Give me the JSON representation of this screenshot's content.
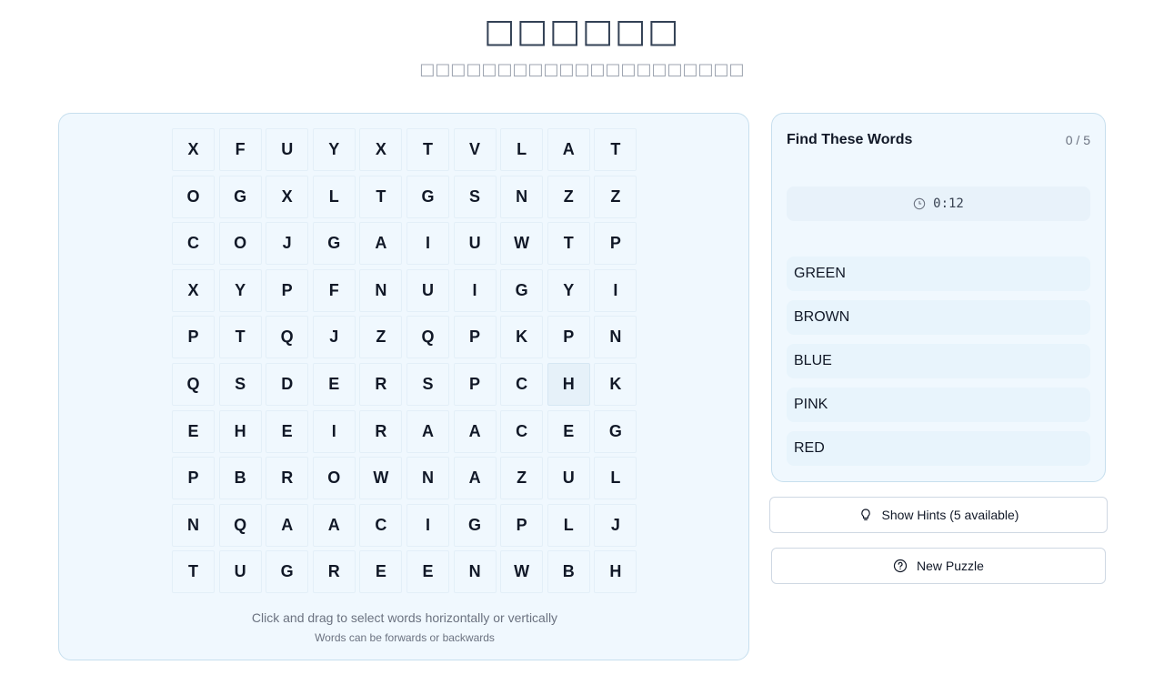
{
  "header": {
    "title": "□□□□□□",
    "subtitle": "□□□□□□□□□□□□□□□□□□□□□"
  },
  "board": {
    "grid": [
      [
        "X",
        "F",
        "U",
        "Y",
        "X",
        "T",
        "V",
        "L",
        "A",
        "T"
      ],
      [
        "O",
        "G",
        "X",
        "L",
        "T",
        "G",
        "S",
        "N",
        "Z",
        "Z"
      ],
      [
        "C",
        "O",
        "J",
        "G",
        "A",
        "I",
        "U",
        "W",
        "T",
        "P"
      ],
      [
        "X",
        "Y",
        "P",
        "F",
        "N",
        "U",
        "I",
        "G",
        "Y",
        "I"
      ],
      [
        "P",
        "T",
        "Q",
        "J",
        "Z",
        "Q",
        "P",
        "K",
        "P",
        "N"
      ],
      [
        "Q",
        "S",
        "D",
        "E",
        "R",
        "S",
        "P",
        "C",
        "H",
        "K"
      ],
      [
        "E",
        "H",
        "E",
        "I",
        "R",
        "A",
        "A",
        "C",
        "E",
        "G"
      ],
      [
        "P",
        "B",
        "R",
        "O",
        "W",
        "N",
        "A",
        "Z",
        "U",
        "L"
      ],
      [
        "N",
        "Q",
        "A",
        "A",
        "C",
        "I",
        "G",
        "P",
        "L",
        "J"
      ],
      [
        "T",
        "U",
        "G",
        "R",
        "E",
        "E",
        "N",
        "W",
        "B",
        "H"
      ]
    ],
    "instruction_primary": "Click and drag to select words horizontally or vertically",
    "instruction_secondary": "Words can be forwards or backwards"
  },
  "panel": {
    "title": "Find These Words",
    "progress": "0 / 5",
    "timer": "0:12",
    "timer_icon": "clock-icon",
    "words": [
      "GREEN",
      "BROWN",
      "BLUE",
      "PINK",
      "RED"
    ]
  },
  "actions": {
    "hints_label": "Show Hints (5 available)",
    "hints_icon": "lightbulb-icon",
    "new_puzzle_label": "New Puzzle",
    "new_puzzle_icon": "help-circle-icon"
  }
}
